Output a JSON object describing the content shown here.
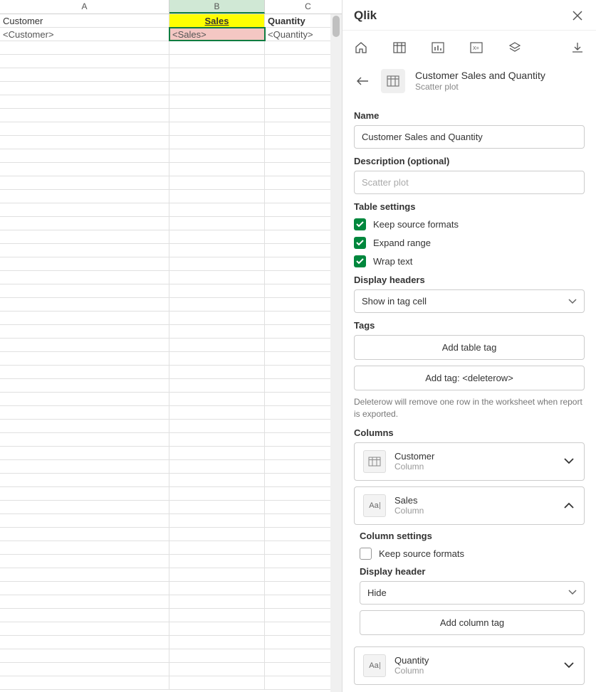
{
  "spreadsheet": {
    "columns": [
      "A",
      "B",
      "C"
    ],
    "headers": {
      "a": "Customer",
      "b": "Sales",
      "c": "Quantity"
    },
    "tags": {
      "a": "<Customer>",
      "b": "<Sales>",
      "c": "<Quantity>"
    }
  },
  "panel": {
    "title": "Qlik",
    "object": {
      "title": "Customer Sales and Quantity",
      "subtitle": "Scatter plot"
    },
    "name": {
      "label": "Name",
      "value": "Customer Sales and Quantity"
    },
    "description": {
      "label": "Description (optional)",
      "placeholder": "Scatter plot"
    },
    "tableSettings": {
      "label": "Table settings",
      "keepSource": "Keep source formats",
      "expandRange": "Expand range",
      "wrapText": "Wrap text"
    },
    "displayHeaders": {
      "label": "Display headers",
      "value": "Show in tag cell"
    },
    "tags": {
      "label": "Tags",
      "addTable": "Add table tag",
      "addDelete": "Add tag: <deleterow>",
      "help": "Deleterow will remove one row in the worksheet when report is exported."
    },
    "columnsSection": {
      "label": "Columns",
      "customer": {
        "name": "Customer",
        "type": "Column"
      },
      "sales": {
        "name": "Sales",
        "type": "Column"
      },
      "quantity": {
        "name": "Quantity",
        "type": "Column"
      },
      "columnSettings": "Column settings",
      "keepSource": "Keep source formats",
      "displayHeader": "Display header",
      "displayHeaderValue": "Hide",
      "addColumnTag": "Add column tag"
    }
  }
}
